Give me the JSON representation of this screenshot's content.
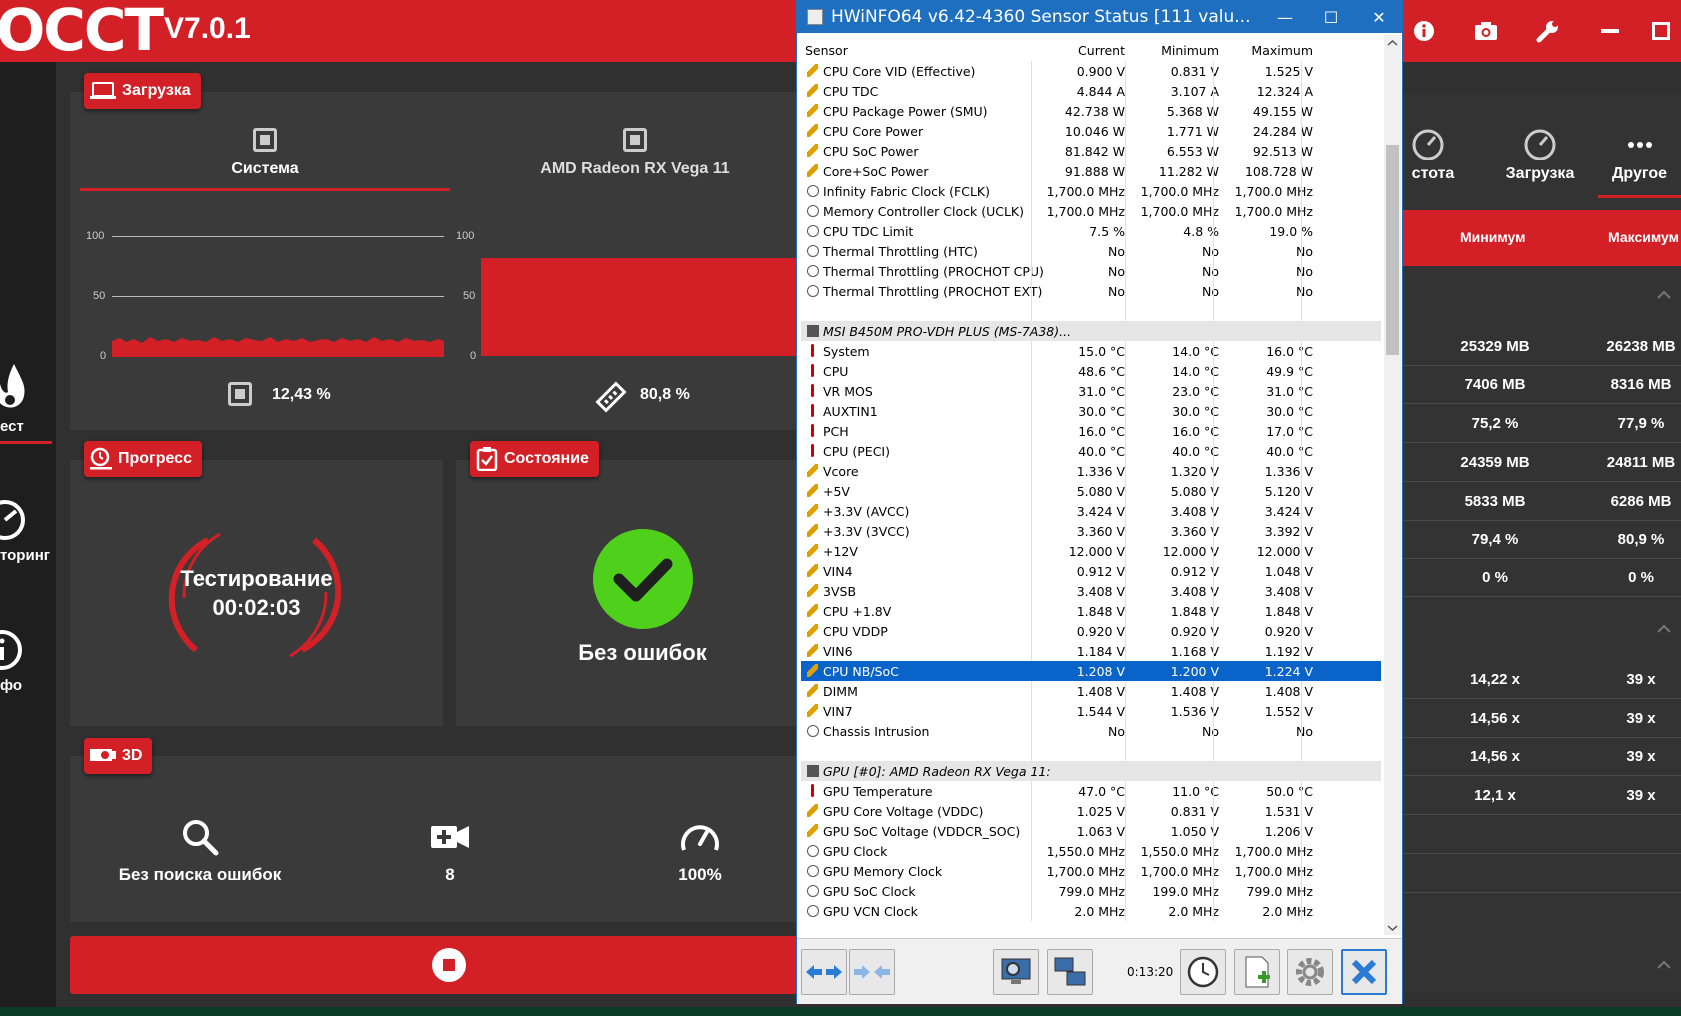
{
  "app": {
    "logo": "OCCT",
    "version": "V7.0.1"
  },
  "sidebar": {
    "test": "ест",
    "monitoring": "торинг",
    "info": "фо"
  },
  "load_card": {
    "badge": "Загрузка",
    "tabs": [
      {
        "label": "Система"
      },
      {
        "label": "AMD Radeon RX Vega 11"
      }
    ],
    "axis": [
      "100",
      "50",
      "0"
    ],
    "system_value": "12,43 %",
    "gpu_value": "80,8 %"
  },
  "progress_card": {
    "badge": "Прогресс",
    "status": "Тестирование",
    "time": "00:02:03"
  },
  "state_card": {
    "badge": "Состояние",
    "status": "Без ошибок"
  },
  "d3_card": {
    "badge": "3D",
    "items": [
      {
        "label": "Без поиска ошибок"
      },
      {
        "label": "8"
      },
      {
        "label": "100%"
      }
    ]
  },
  "right_panel": {
    "tabs": [
      {
        "label": "стота"
      },
      {
        "label": "Загрузка"
      },
      {
        "label": "Другое"
      }
    ],
    "headers": {
      "min": "Минимум",
      "max": "Максимум"
    },
    "rows": [
      {
        "min": "25329 MB",
        "max": "26238 MB"
      },
      {
        "min": "7406 MB",
        "max": "8316 MB"
      },
      {
        "min": "75,2 %",
        "max": "77,9 %"
      },
      {
        "min": "24359 MB",
        "max": "24811 MB"
      },
      {
        "min": "5833 MB",
        "max": "6286 MB"
      },
      {
        "min": "79,4 %",
        "max": "80,9 %"
      },
      {
        "min": "0 %",
        "max": "0 %"
      },
      {
        "min": "14,22 x",
        "max": "39 x"
      },
      {
        "min": "14,56 x",
        "max": "39 x"
      },
      {
        "min": "14,56 x",
        "max": "39 x"
      },
      {
        "min": "12,1 x",
        "max": "39 x"
      }
    ]
  },
  "hwinfo": {
    "title": "HWiNFO64 v6.42-4360 Sensor Status [111 valu...",
    "columns": {
      "sensor": "Sensor",
      "current": "Current",
      "min": "Minimum",
      "max": "Maximum"
    },
    "rows": [
      {
        "icon": "volt",
        "name": "CPU Core VID (Effective)",
        "cur": "0.900 V",
        "min": "0.831 V",
        "max": "1.525 V"
      },
      {
        "icon": "volt",
        "name": "CPU TDC",
        "cur": "4.844 A",
        "min": "3.107 A",
        "max": "12.324 A"
      },
      {
        "icon": "volt",
        "name": "CPU Package Power (SMU)",
        "cur": "42.738 W",
        "min": "5.368 W",
        "max": "49.155 W"
      },
      {
        "icon": "volt",
        "name": "CPU Core Power",
        "cur": "10.046 W",
        "min": "1.771 W",
        "max": "24.284 W"
      },
      {
        "icon": "volt",
        "name": "CPU SoC Power",
        "cur": "81.842 W",
        "min": "6.553 W",
        "max": "92.513 W"
      },
      {
        "icon": "volt",
        "name": "Core+SoC Power",
        "cur": "91.888 W",
        "min": "11.282 W",
        "max": "108.728 W"
      },
      {
        "icon": "clock",
        "name": "Infinity Fabric Clock (FCLK)",
        "cur": "1,700.0 MHz",
        "min": "1,700.0 MHz",
        "max": "1,700.0 MHz"
      },
      {
        "icon": "clock",
        "name": "Memory Controller Clock (UCLK)",
        "cur": "1,700.0 MHz",
        "min": "1,700.0 MHz",
        "max": "1,700.0 MHz"
      },
      {
        "icon": "clock",
        "name": "CPU TDC Limit",
        "cur": "7.5 %",
        "min": "4.8 %",
        "max": "19.0 %"
      },
      {
        "icon": "clock",
        "name": "Thermal Throttling (HTC)",
        "cur": "No",
        "min": "No",
        "max": "No"
      },
      {
        "icon": "clock",
        "name": "Thermal Throttling (PROCHOT CPU)",
        "cur": "No",
        "min": "No",
        "max": "No"
      },
      {
        "icon": "clock",
        "name": "Thermal Throttling (PROCHOT EXT)",
        "cur": "No",
        "min": "No",
        "max": "No"
      },
      {
        "icon": "blank",
        "name": "",
        "cur": "",
        "min": "",
        "max": ""
      },
      {
        "icon": "chip",
        "name": "MSI B450M PRO-VDH PLUS (MS-7A38)...",
        "cur": "",
        "min": "",
        "max": "",
        "group": true
      },
      {
        "icon": "temp",
        "name": "System",
        "cur": "15.0 °C",
        "min": "14.0 °C",
        "max": "16.0 °C"
      },
      {
        "icon": "temp",
        "name": "CPU",
        "cur": "48.6 °C",
        "min": "14.0 °C",
        "max": "49.9 °C"
      },
      {
        "icon": "temp",
        "name": "VR MOS",
        "cur": "31.0 °C",
        "min": "23.0 °C",
        "max": "31.0 °C"
      },
      {
        "icon": "temp",
        "name": "AUXTIN1",
        "cur": "30.0 °C",
        "min": "30.0 °C",
        "max": "30.0 °C"
      },
      {
        "icon": "temp",
        "name": "PCH",
        "cur": "16.0 °C",
        "min": "16.0 °C",
        "max": "17.0 °C"
      },
      {
        "icon": "temp",
        "name": "CPU (PECI)",
        "cur": "40.0 °C",
        "min": "40.0 °C",
        "max": "40.0 °C"
      },
      {
        "icon": "volt",
        "name": "Vcore",
        "cur": "1.336 V",
        "min": "1.320 V",
        "max": "1.336 V"
      },
      {
        "icon": "volt",
        "name": "+5V",
        "cur": "5.080 V",
        "min": "5.080 V",
        "max": "5.120 V"
      },
      {
        "icon": "volt",
        "name": "+3.3V (AVCC)",
        "cur": "3.424 V",
        "min": "3.408 V",
        "max": "3.424 V"
      },
      {
        "icon": "volt",
        "name": "+3.3V (3VCC)",
        "cur": "3.360 V",
        "min": "3.360 V",
        "max": "3.392 V"
      },
      {
        "icon": "volt",
        "name": "+12V",
        "cur": "12.000 V",
        "min": "12.000 V",
        "max": "12.000 V"
      },
      {
        "icon": "volt",
        "name": "VIN4",
        "cur": "0.912 V",
        "min": "0.912 V",
        "max": "1.048 V"
      },
      {
        "icon": "volt",
        "name": "3VSB",
        "cur": "3.408 V",
        "min": "3.408 V",
        "max": "3.408 V"
      },
      {
        "icon": "volt",
        "name": "CPU +1.8V",
        "cur": "1.848 V",
        "min": "1.848 V",
        "max": "1.848 V"
      },
      {
        "icon": "volt",
        "name": "CPU VDDP",
        "cur": "0.920 V",
        "min": "0.920 V",
        "max": "0.920 V"
      },
      {
        "icon": "volt",
        "name": "VIN6",
        "cur": "1.184 V",
        "min": "1.168 V",
        "max": "1.192 V"
      },
      {
        "icon": "volt",
        "name": "CPU NB/SoC",
        "cur": "1.208 V",
        "min": "1.200 V",
        "max": "1.224 V",
        "selected": true
      },
      {
        "icon": "volt",
        "name": "DIMM",
        "cur": "1.408 V",
        "min": "1.408 V",
        "max": "1.408 V"
      },
      {
        "icon": "volt",
        "name": "VIN7",
        "cur": "1.544 V",
        "min": "1.536 V",
        "max": "1.552 V"
      },
      {
        "icon": "clock",
        "name": "Chassis Intrusion",
        "cur": "No",
        "min": "No",
        "max": "No"
      },
      {
        "icon": "blank",
        "name": "",
        "cur": "",
        "min": "",
        "max": ""
      },
      {
        "icon": "chip",
        "name": "GPU [#0]: AMD Radeon RX Vega 11:",
        "cur": "",
        "min": "",
        "max": "",
        "group": true
      },
      {
        "icon": "temp",
        "name": "GPU Temperature",
        "cur": "47.0 °C",
        "min": "11.0 °C",
        "max": "50.0 °C"
      },
      {
        "icon": "volt",
        "name": "GPU Core Voltage (VDDC)",
        "cur": "1.025 V",
        "min": "0.831 V",
        "max": "1.531 V"
      },
      {
        "icon": "volt",
        "name": "GPU SoC Voltage (VDDCR_SOC)",
        "cur": "1.063 V",
        "min": "1.050 V",
        "max": "1.206 V"
      },
      {
        "icon": "clock",
        "name": "GPU Clock",
        "cur": "1,550.0 MHz",
        "min": "1,550.0 MHz",
        "max": "1,700.0 MHz"
      },
      {
        "icon": "clock",
        "name": "GPU Memory Clock",
        "cur": "1,700.0 MHz",
        "min": "1,700.0 MHz",
        "max": "1,700.0 MHz"
      },
      {
        "icon": "clock",
        "name": "GPU SoC Clock",
        "cur": "799.0 MHz",
        "min": "199.0 MHz",
        "max": "799.0 MHz"
      },
      {
        "icon": "clock",
        "name": "GPU VCN Clock",
        "cur": "2.0 MHz",
        "min": "2.0 MHz",
        "max": "2.0 MHz"
      }
    ],
    "timer": "0:13:20"
  },
  "colors": {
    "accent": "#d32027",
    "ok": "#4fd11b",
    "selection": "#0a63c9",
    "titlebar": "#1e6fbf"
  }
}
